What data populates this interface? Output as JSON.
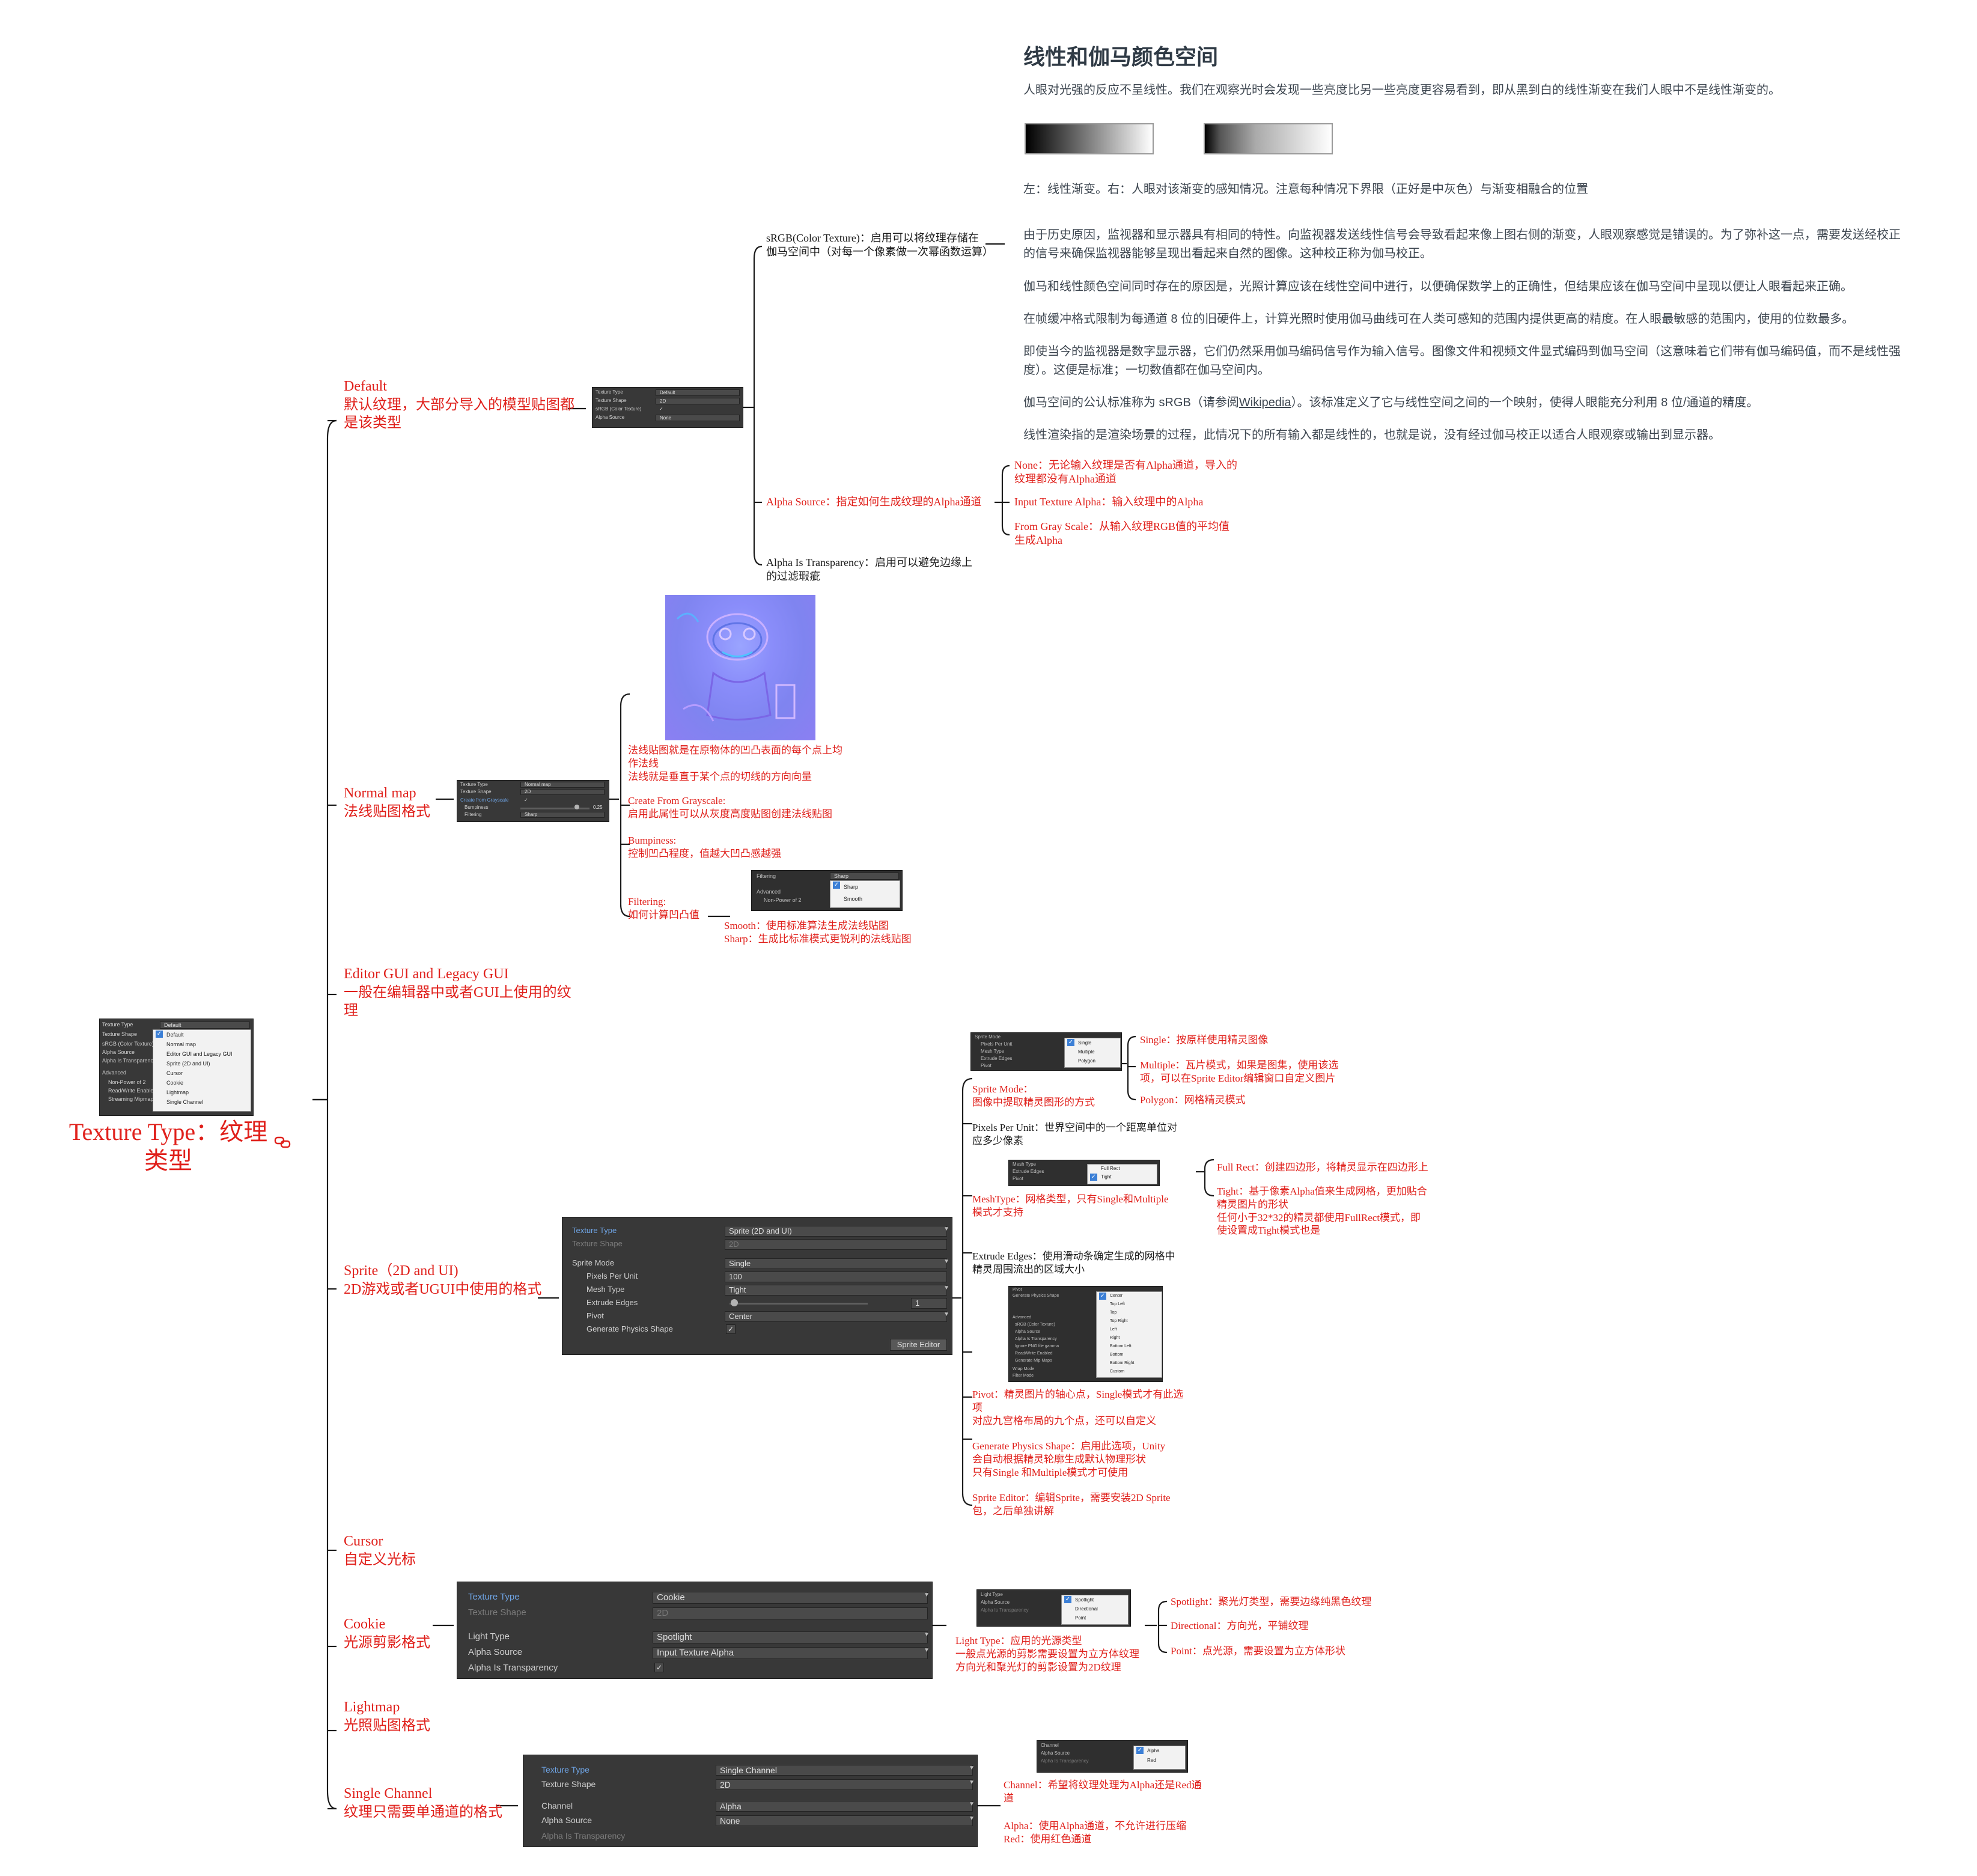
{
  "root": {
    "title_lines": [
      "Texture Type：纹理",
      "类型"
    ]
  },
  "root_panel": {
    "labels": [
      "Texture Type",
      "Texture Shape",
      "sRGB (Color Texture)",
      "Alpha Source",
      "Alpha Is Transparency",
      "Advanced",
      "Non-Power of 2",
      "Read/Write Enabled",
      "Streaming Mipmaps"
    ],
    "selected": "Default",
    "menu": [
      "Default",
      "Normal map",
      "Editor GUI and Legacy GUI",
      "Sprite (2D and UI)",
      "Cursor",
      "Cookie",
      "Lightmap",
      "Single Channel"
    ]
  },
  "default": {
    "title": "Default",
    "desc_lines": [
      "默认纹理，大部分导入的模型贴图都",
      "是该类型"
    ],
    "panel": [
      {
        "label": "Texture Type",
        "value": "Default"
      },
      {
        "label": "Texture Shape",
        "value": "2D"
      },
      {
        "label": "sRGB (Color Texture)",
        "value": "✓"
      },
      {
        "label": "Alpha Source",
        "value": "None"
      }
    ],
    "srgb_lines": [
      "sRGB(Color Texture)：启用可以将纹理存储在",
      "伽马空间中（对每一个像素做一次幂函数运算）"
    ],
    "alpha_source": "Alpha Source：指定如何生成纹理的Alpha通道",
    "alpha_options": [
      {
        "lines": [
          "None：无论输入纹理是否有Alpha通道，导入的",
          "纹理都没有Alpha通道"
        ]
      },
      {
        "lines": [
          "Input Texture Alpha：输入纹理中的Alpha"
        ]
      },
      {
        "lines": [
          "From Gray Scale：从输入纹理RGB值的平均值",
          "生成Alpha"
        ]
      }
    ],
    "alpha_transparency_lines": [
      "Alpha Is Transparency：启用可以避免边缘上",
      "的过滤瑕疵"
    ]
  },
  "gamma_note": {
    "heading": "线性和伽马颜色空间",
    "intro": "人眼对光强的反应不呈线性。我们在观察光时会发现一些亮度比另一些亮度更容易看到，即从黑到白的线性渐变在我们人眼中不是线性渐变的。",
    "caption": "左：线性渐变。右：人眼对该渐变的感知情况。注意每种情况下界限（正好是中灰色）与渐变相融合的位置",
    "para1_lines": [
      "由于历史原因，监视器和显示器具有相同的特性。向监视器发送线性信号会导致看起来像上图右侧的渐变，人眼观察感觉是错误的。为了弥补这一点，需要发送经校正",
      "的信号来确保监视器能够呈现出看起来自然的图像。这种校正称为伽马校正。"
    ],
    "para2": "伽马和线性颜色空间同时存在的原因是，光照计算应该在线性空间中进行，以便确保数学上的正确性，但结果应该在伽马空间中呈现以便让人眼看起来正确。",
    "para3": "在帧缓冲格式限制为每通道 8 位的旧硬件上，计算光照时使用伽马曲线可在人类可感知的范围内提供更高的精度。在人眼最敏感的范围内，使用的位数最多。",
    "para4_lines": [
      "即使当今的监视器是数字显示器，它们仍然采用伽马编码信号作为输入信号。图像文件和视频文件显式编码到伽马空间（这意味着它们带有伽马编码值，而不是线性强",
      "度）。这便是标准；一切数值都在伽马空间内。"
    ],
    "para5_a": "伽马空间的公认标准称为 sRGB（请参阅",
    "para5_link": "Wikipedia",
    "para5_b": "）。该标准定义了它与线性空间之间的一个映射，使得人眼能充分利用 8 位/通道的精度。",
    "para6": "线性渲染指的是渲染场景的过程，此情况下的所有输入都是线性的，也就是说，没有经过伽马校正以适合人眼观察或输出到显示器。"
  },
  "normal_map": {
    "title": "Normal map",
    "desc": "法线贴图格式",
    "panel": [
      {
        "label": "Texture Type",
        "value": "Normal map"
      },
      {
        "label": "Texture Shape",
        "value": "2D"
      },
      {
        "label": "Create from Grayscale",
        "value": "✓"
      },
      {
        "label": "Bumpiness",
        "value": "0.25"
      },
      {
        "label": "Filtering",
        "value": "Sharp"
      }
    ],
    "intro_lines": [
      "法线贴图就是在原物体的凹凸表面的每个点上均",
      "作法线",
      "法线就是垂直于某个点的切线的方向向量"
    ],
    "grayscale": [
      "Create From Grayscale:",
      "启用此属性可以从灰度高度贴图创建法线贴图"
    ],
    "bumpiness": [
      "Bumpiness:",
      "控制凹凸程度，值越大凹凸感越强"
    ],
    "filtering": [
      "Filtering:",
      "如何计算凹凸值"
    ],
    "filter_shot": {
      "rows": [
        "Filtering",
        "Advanced",
        "Non-Power of 2"
      ],
      "selected": "Sharp",
      "menu": [
        "Sharp",
        "Smooth"
      ]
    },
    "filter_opts": [
      "Smooth：使用标准算法生成法线贴图",
      "Sharp：生成比标准模式更锐利的法线贴图"
    ]
  },
  "editor_gui": {
    "title": "Editor GUI and Legacy GUI",
    "desc_lines": [
      "一般在编辑器中或者GUI上使用的纹",
      "理"
    ]
  },
  "sprite": {
    "title": "Sprite（2D and UI)",
    "desc": "2D游戏或者UGUI中使用的格式",
    "panel": [
      {
        "label": "Texture Type",
        "value": "Sprite (2D and UI)"
      },
      {
        "label": "Texture Shape",
        "value": "2D"
      },
      {
        "label": "Sprite Mode",
        "value": "Single"
      },
      {
        "label": "Pixels Per Unit",
        "value": "100"
      },
      {
        "label": "Mesh Type",
        "value": "Tight"
      },
      {
        "label": "Extrude Edges",
        "value": "1"
      },
      {
        "label": "Pivot",
        "value": "Center"
      },
      {
        "label": "Generate Physics Shape",
        "value": "✓"
      }
    ],
    "editor_button": "Sprite Editor",
    "mode_shot": {
      "rows": [
        "Sprite Mode",
        "Pixels Per Unit",
        "Mesh Type",
        "Extrude Edges",
        "Pivot"
      ],
      "menu": [
        "Single",
        "Multiple",
        "Polygon"
      ]
    },
    "sprite_mode": [
      "Sprite Mode：",
      "图像中提取精灵图形的方式"
    ],
    "mode_opts": [
      {
        "lines": [
          "Single：按原样使用精灵图像"
        ]
      },
      {
        "lines": [
          "Multiple：瓦片模式，如果是图集，使用该选",
          "项，可以在Sprite Editor编辑窗口自定义图片"
        ]
      },
      {
        "lines": [
          "Polygon：网格精灵模式"
        ]
      }
    ],
    "ppu": [
      "Pixels Per Unit：世界空间中的一个距离单位对",
      "应多少像素"
    ],
    "mesh_shot": {
      "rows": [
        "Mesh Type",
        "Extrude Edges",
        "Pivot"
      ],
      "menu": [
        "Full Rect",
        "Tight"
      ]
    },
    "mesh_type": [
      "MeshType：网格类型，只有Single和Multiple",
      "模式才支持"
    ],
    "mesh_opts": [
      {
        "lines": [
          "Full Rect：创建四边形，将精灵显示在四边形上"
        ]
      },
      {
        "lines": [
          "Tight：基于像素Alpha值来生成网格，更加贴合",
          "精灵图片的形状",
          "任何小于32*32的精灵都使用FullRect模式，即",
          "使设置成Tight模式也是"
        ]
      }
    ],
    "extrude": [
      "Extrude Edges：使用滑动条确定生成的网格中",
      "精灵周围流出的区域大小"
    ],
    "pivot_shot": {
      "rows": [
        "Pivot",
        "Generate Physics Shape",
        "Advanced",
        "sRGB (Color Texture)",
        "Alpha Source",
        "Alpha Is Transparency",
        "Ignore PNG file gamma",
        "Read/Write Enabled",
        "Generate Mip Maps",
        "Wrap Mode",
        "Filter Mode"
      ],
      "menu": [
        "Center",
        "Top Left",
        "Top",
        "Top Right",
        "Left",
        "Right",
        "Bottom Left",
        "Bottom",
        "Bottom Right",
        "Custom"
      ]
    },
    "pivot": [
      "Pivot：精灵图片的轴心点，Single模式才有此选",
      "项",
      "对应九宫格布局的九个点，还可以自定义"
    ],
    "physics": [
      "Generate Physics Shape：启用此选项，Unity",
      "会自动根据精灵轮廓生成默认物理形状",
      "只有Single 和Multiple模式才可使用"
    ],
    "sprite_editor": [
      "Sprite Editor：编辑Sprite，需要安装2D Sprite",
      "包，之后单独讲解"
    ]
  },
  "cursor": {
    "title": "Cursor",
    "desc": "自定义光标"
  },
  "cookie": {
    "title": "Cookie",
    "desc": "光源剪影格式",
    "panel": [
      {
        "label": "Texture Type",
        "value": "Cookie"
      },
      {
        "label": "Texture Shape",
        "value": "2D"
      },
      {
        "label": "Light Type",
        "value": "Spotlight"
      },
      {
        "label": "Alpha Source",
        "value": "Input Texture Alpha"
      },
      {
        "label": "Alpha Is Transparency",
        "value": "✓"
      }
    ],
    "light_shot": {
      "rows": [
        "Light Type",
        "Alpha Source",
        "Alpha Is Transparency"
      ],
      "menu": [
        "Spotlight",
        "Directional",
        "Point"
      ]
    },
    "light_type": [
      "Light Type：应用的光源类型",
      "一般点光源的剪影需要设置为立方体纹理",
      "方向光和聚光灯的剪影设置为2D纹理"
    ],
    "light_opts": [
      "Spotlight：聚光灯类型，需要边缘纯黑色纹理",
      "Directional：方向光，平铺纹理",
      "Point：点光源，需要设置为立方体形状"
    ]
  },
  "lightmap": {
    "title": "Lightmap",
    "desc": "光照贴图格式"
  },
  "single_channel": {
    "title": "Single Channel",
    "desc": "纹理只需要单通道的格式",
    "panel": [
      {
        "label": "Texture Type",
        "value": "Single Channel"
      },
      {
        "label": "Texture Shape",
        "value": "2D"
      },
      {
        "label": "Channel",
        "value": "Alpha"
      },
      {
        "label": "Alpha Source",
        "value": "None"
      },
      {
        "label": "Alpha Is Transparency",
        "value": ""
      }
    ],
    "channel_shot": {
      "rows": [
        "Channel",
        "Alpha Source",
        "Alpha Is Transparency"
      ],
      "menu": [
        "Alpha",
        "Red"
      ]
    },
    "channel": [
      "Channel：希望将纹理处理为Alpha还是Red通",
      "道"
    ],
    "channel_opts": [
      "Alpha：使用Alpha通道，不允许进行压缩",
      "Red：使用红色通道"
    ]
  },
  "colors": {
    "branch": "#e0201b",
    "line": "#1a1a1a",
    "panel": "#383838"
  }
}
